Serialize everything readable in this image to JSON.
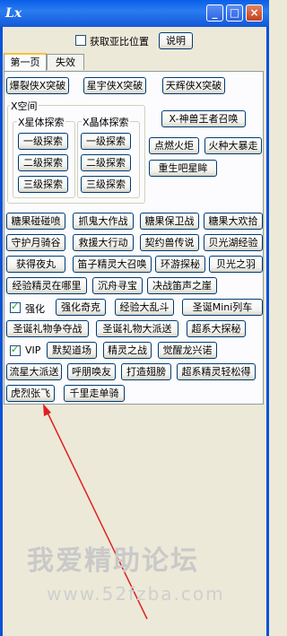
{
  "window": {
    "logo": "Lx",
    "minimize": "_",
    "maximize": "□",
    "close": "×"
  },
  "top": {
    "checkbox_label": "获取亚比位置",
    "explain_button": "说明"
  },
  "tabs": [
    "第一页",
    "失效"
  ],
  "row1": [
    "爆裂侠X突破",
    "星宇侠X突破",
    "天辉侠X突破"
  ],
  "xspace": {
    "title": "X空间",
    "star": {
      "title": "X星体探索",
      "buttons": [
        "一级探索",
        "二级探索",
        "三级探索"
      ]
    },
    "crystal": {
      "title": "X晶体探索",
      "buttons": [
        "一级探索",
        "二级探索",
        "三级探索"
      ]
    }
  },
  "side_buttons": [
    "X-神兽王者召唤",
    "点燃火炬",
    "火种大暴走",
    "重生吧星眸"
  ],
  "grid": [
    [
      "糖果碰碰喷",
      "抓鬼大作战",
      "糖果保卫战",
      "糖果大欢拾"
    ],
    [
      "守护月骑谷",
      "救援大行动",
      "契约兽传说",
      "贝光湖经验"
    ],
    [
      "获得夜丸",
      "笛子精灵大召唤",
      "环游探秘",
      "贝光之羽"
    ],
    [
      "经验精灵在哪里",
      "沉舟寻宝",
      "决战笛声之崖"
    ]
  ],
  "enhance": {
    "checkbox_label": "强化",
    "checked": true,
    "buttons": [
      "强化奇克",
      "经验大乱斗",
      "圣诞Mini列车"
    ]
  },
  "christmas": [
    "圣诞礼物争夺战",
    "圣诞礼物大派送",
    "超系大探秘"
  ],
  "vip": {
    "checkbox_label": "VIP",
    "checked": true,
    "buttons": [
      "默契道场",
      "精灵之战",
      "觉醒龙兴诺"
    ]
  },
  "row_last1": [
    "流星大派送",
    "呼朋唤友",
    "打造翅膀",
    "超系精灵轻松得"
  ],
  "row_last2": [
    "虎烈张飞",
    "千里走单骑"
  ],
  "watermark": {
    "title": "我爱精助论坛",
    "url": "www.52fzba.com"
  }
}
